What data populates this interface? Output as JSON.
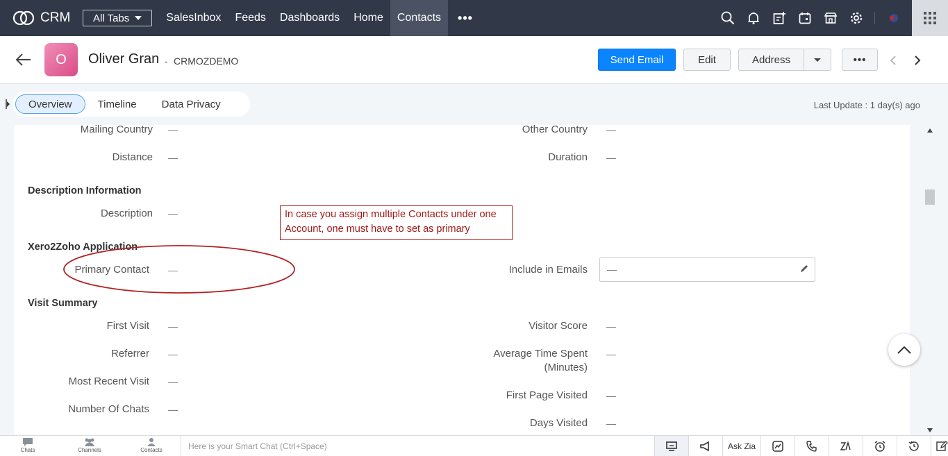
{
  "nav": {
    "brand": "CRM",
    "all_tabs": "All Tabs",
    "items": [
      "SalesInbox",
      "Feeds",
      "Dashboards",
      "Home",
      "Contacts"
    ],
    "active": "Contacts",
    "more": "•••"
  },
  "record": {
    "avatar_letter": "O",
    "name": "Oliver Gran",
    "separator": "-",
    "subtitle": "CRMOZDEMO",
    "send_email": "Send Email",
    "edit": "Edit",
    "address": "Address",
    "more": "•••"
  },
  "tabs": {
    "items": [
      "Overview",
      "Timeline",
      "Data Privacy"
    ],
    "last_update": "Last Update : 1 day(s) ago"
  },
  "fields": {
    "mailing_country": {
      "label": "Mailing Country",
      "value": "—"
    },
    "other_country": {
      "label": "Other Country",
      "value": "—"
    },
    "distance": {
      "label": "Distance",
      "value": "—"
    },
    "duration": {
      "label": "Duration",
      "value": "—"
    },
    "description_section": "Description Information",
    "description": {
      "label": "Description",
      "value": "—"
    },
    "xero_section": "Xero2Zoho Application",
    "primary_contact": {
      "label": "Primary Contact",
      "value": "—"
    },
    "include_in_emails": {
      "label": "Include in Emails",
      "value": "—"
    },
    "visit_section": "Visit Summary",
    "first_visit": {
      "label": "First Visit",
      "value": "—"
    },
    "visitor_score": {
      "label": "Visitor Score",
      "value": "—"
    },
    "referrer": {
      "label": "Referrer",
      "value": "—"
    },
    "avg_time_line1": "Average Time Spent",
    "avg_time_line2": "(Minutes)",
    "avg_time_value": "—",
    "most_recent_visit": {
      "label": "Most Recent Visit",
      "value": "—"
    },
    "first_page_visited": {
      "label": "First Page Visited",
      "value": "—"
    },
    "number_of_chats": {
      "label": "Number Of Chats",
      "value": "—"
    },
    "days_visited": {
      "label": "Days Visited",
      "value": "—"
    }
  },
  "annotation": {
    "note": "In case you assign multiple Contacts under one Account, one must have to set as primary",
    "color": "#b22222"
  },
  "bottom": {
    "chats": "Chats",
    "channels": "Channels",
    "contacts": "Contacts",
    "smartchat_placeholder": "Here is your Smart Chat (Ctrl+Space)",
    "ask_zia": "Ask Zia"
  },
  "colors": {
    "nav_bg": "#313949",
    "primary": "#0a84ff",
    "avatar": "#e0659a"
  }
}
